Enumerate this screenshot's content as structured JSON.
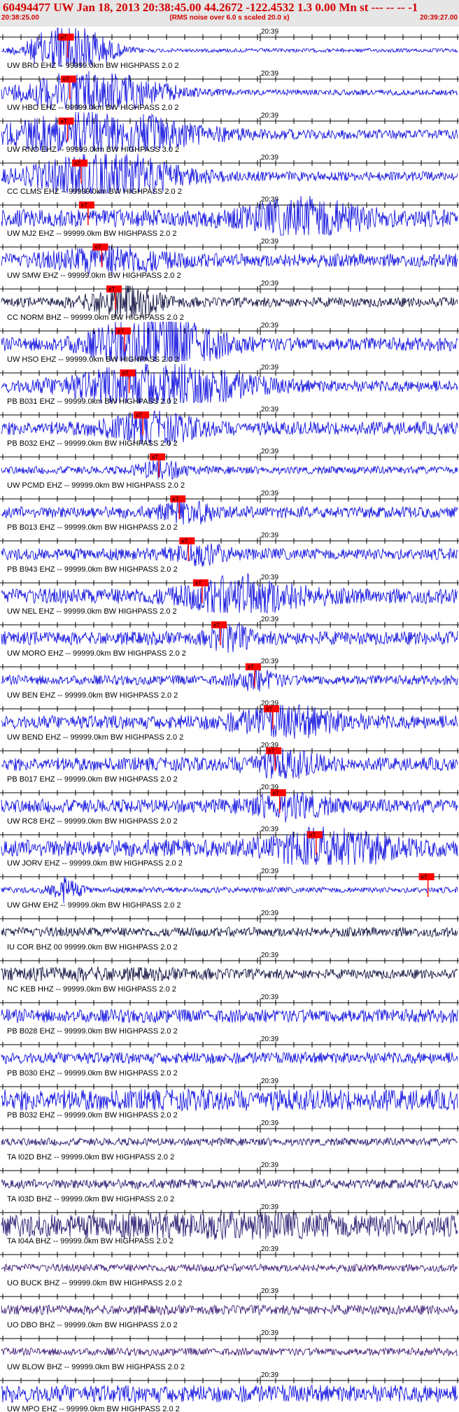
{
  "header": {
    "title": "60494477 UW Jan 18, 2013 20:38:45.00   44.2672 -122.4532  1.3 0.00 Mn st --- -- --  -1",
    "start_time": "20:38:25.00",
    "center_text": "(RMS noise over 6.0 s scaled 20.0 x)",
    "end_time": "20:39:27.00"
  },
  "time_mark_label": "20:39",
  "pick_label": "eT",
  "colors": {
    "header_text": "#d40000",
    "header_bg": "#e6e6e6",
    "trace_blue": "#0000dd",
    "trace_dark": "#000033",
    "trace_navy": "#1a0a66",
    "trace_purple": "#33106e",
    "pick": "#ff0000",
    "axis": "#000000"
  },
  "traces": [
    {
      "label": "UW BRO EHZ -- 99999.0km BW  HIGHPASS  2.0  2",
      "color": "blue",
      "pick": 0.145,
      "ev": 0.15,
      "amp": 0.1,
      "ea": 1.6,
      "ew": 0.08
    },
    {
      "label": "UW HBO EHZ -- 99999.0km BW  HIGHPASS  2.0  2",
      "color": "blue",
      "pick": 0.15,
      "ev": 0.2,
      "amp": 0.15,
      "ea": 1.1,
      "ew": 0.15
    },
    {
      "label": "UW RNO EHZ -- 99999.0km BW  HIGHPASS  3.0  2",
      "color": "blue",
      "pick": 0.145,
      "ev": 0.22,
      "amp": 0.25,
      "ea": 1.1,
      "ew": 0.2
    },
    {
      "label": "CC CLMS EHZ -- 99999.0km BW  HIGHPASS  2.0  2",
      "color": "blue",
      "pick": 0.175,
      "ev": 0.23,
      "amp": 0.25,
      "ea": 1.2,
      "ew": 0.15
    },
    {
      "label": "UW MJ2 EHZ -- 99999.0km BW  HIGHPASS  2.0  2",
      "color": "blue",
      "pick": 0.19,
      "ev": 0.67,
      "amp": 0.45,
      "ea": 0.8,
      "ew": 0.12
    },
    {
      "label": "UW SMW EHZ -- 99999.0km BW  HIGHPASS  2.0  2",
      "color": "blue",
      "pick": 0.22,
      "ev": 0.24,
      "amp": 0.35,
      "ea": 0.5,
      "ew": 0.12
    },
    {
      "label": "CC NORM BHZ -- 99999.0km BW  HIGHPASS  2.0  2",
      "color": "dark",
      "pick": 0.25,
      "ev": 0.27,
      "amp": 0.25,
      "ea": 0.7,
      "ew": 0.08
    },
    {
      "label": "UW HSO EHZ -- 99999.0km BW  HIGHPASS  2.0  2",
      "color": "blue",
      "pick": 0.27,
      "ev": 0.34,
      "amp": 0.35,
      "ea": 1.6,
      "ew": 0.12
    },
    {
      "label": "PB B031 EHZ -- 99999.0km BW  HIGHPASS  2.0  2",
      "color": "blue",
      "pick": 0.28,
      "ev": 0.35,
      "amp": 0.3,
      "ea": 1.1,
      "ew": 0.18
    },
    {
      "label": "PB B032 EHZ -- 99999.0km BW  HIGHPASS  2.0  2",
      "color": "blue",
      "pick": 0.31,
      "ev": 0.33,
      "amp": 0.35,
      "ea": 0.6,
      "ew": 0.1
    },
    {
      "label": "UW PCMD EHZ -- 99999.0km BW  HIGHPASS  2.0  2",
      "color": "blue",
      "pick": 0.345,
      "ev": 0.35,
      "amp": 0.2,
      "ea": 0.4,
      "ew": 0.05
    },
    {
      "label": "PB B013 EHZ -- 99999.0km BW  HIGHPASS  2.0  2",
      "color": "blue",
      "pick": 0.39,
      "ev": 0.41,
      "amp": 0.3,
      "ea": 0.4,
      "ew": 0.06
    },
    {
      "label": "PB B943 EHZ -- 99999.0km BW  HIGHPASS  2.0  2",
      "color": "blue",
      "pick": 0.41,
      "ev": 0.43,
      "amp": 0.3,
      "ea": 0.4,
      "ew": 0.06
    },
    {
      "label": "UW NEL EHZ -- 99999.0km BW  HIGHPASS  2.0  2",
      "color": "blue",
      "pick": 0.44,
      "ev": 0.53,
      "amp": 0.4,
      "ea": 0.8,
      "ew": 0.12
    },
    {
      "label": "UW MORO EHZ -- 99999.0km BW  HIGHPASS  2.0  2",
      "color": "blue",
      "pick": 0.48,
      "ev": 0.5,
      "amp": 0.35,
      "ea": 0.6,
      "ew": 0.04
    },
    {
      "label": "UW BEN EHZ -- 99999.0km BW  HIGHPASS  2.0  2",
      "color": "blue",
      "pick": 0.555,
      "ev": 0.56,
      "amp": 0.25,
      "ea": 0.4,
      "ew": 0.05
    },
    {
      "label": "UW BEND EHZ -- 99999.0km BW  HIGHPASS  2.0  2",
      "color": "blue",
      "pick": 0.595,
      "ev": 0.63,
      "amp": 0.35,
      "ea": 0.6,
      "ew": 0.12
    },
    {
      "label": "PB B017 EHZ -- 99999.0km BW  HIGHPASS  2.0  2",
      "color": "blue",
      "pick": 0.6,
      "ev": 0.62,
      "amp": 0.35,
      "ea": 0.5,
      "ew": 0.08
    },
    {
      "label": "UW RC8 EHZ -- 99999.0km BW  HIGHPASS  2.0  2",
      "color": "blue",
      "pick": 0.61,
      "ev": 0.63,
      "amp": 0.35,
      "ea": 0.5,
      "ew": 0.08
    },
    {
      "label": "UW JORV EHZ -- 99999.0km BW  HIGHPASS  2.0  2",
      "color": "blue",
      "pick": 0.69,
      "ev": 0.72,
      "amp": 0.45,
      "ea": 0.8,
      "ew": 0.12
    },
    {
      "label": "UW GHW EHZ -- 99999.0km BW  HIGHPASS  2.0  2",
      "color": "blue",
      "pick": 0.935,
      "ev": 0.14,
      "amp": 0.15,
      "ea": 0.6,
      "ew": 0.03
    },
    {
      "label": "IU COR BHZ 00 99999.0km BW  HIGHPASS  2.0  2",
      "color": "dark",
      "pick": null,
      "ev": 0.5,
      "amp": 0.25,
      "ea": 0,
      "ew": 0.1
    },
    {
      "label": "NC KEB HHZ -- 99999.0km BW  HIGHPASS  2.0  2",
      "color": "dark",
      "pick": null,
      "ev": 0.2,
      "amp": 0.25,
      "ea": 0.15,
      "ew": 0.25
    },
    {
      "label": "PB B028 EHZ -- 99999.0km BW  HIGHPASS  2.0  2",
      "color": "blue",
      "pick": null,
      "ev": 0.5,
      "amp": 0.35,
      "ea": 0,
      "ew": 0.1
    },
    {
      "label": "PB B030 EHZ -- 99999.0km BW  HIGHPASS  2.0  2",
      "color": "blue",
      "pick": null,
      "ev": 0.5,
      "amp": 0.3,
      "ea": 0,
      "ew": 0.1
    },
    {
      "label": "PB B032 EHZ -- 99999.0km BW  HIGHPASS  2.0  2",
      "color": "blue",
      "pick": null,
      "ev": 0.5,
      "amp": 0.55,
      "ea": 0,
      "ew": 0.1
    },
    {
      "label": "TA I02D BHZ -- 99999.0km BW  HIGHPASS  2.0  2",
      "color": "navy",
      "pick": null,
      "ev": 0.5,
      "amp": 0.2,
      "ea": 0,
      "ew": 0.1
    },
    {
      "label": "TA I03D BHZ -- 99999.0km BW  HIGHPASS  2.0  2",
      "color": "navy",
      "pick": null,
      "ev": 0.5,
      "amp": 0.25,
      "ea": 0,
      "ew": 0.1
    },
    {
      "label": "TA I04A BHZ -- 99999.0km BW  HIGHPASS  2.0  2",
      "color": "navy",
      "pick": null,
      "ev": 0.5,
      "amp": 0.55,
      "ea": 0.2,
      "ew": 0.3
    },
    {
      "label": "UO BUCK BHZ -- 99999.0km BW  HIGHPASS  2.0  2",
      "color": "purple",
      "pick": null,
      "ev": 0.5,
      "amp": 0.2,
      "ea": 0,
      "ew": 0.1
    },
    {
      "label": "UO DBO BHZ -- 99999.0km BW  HIGHPASS  2.0  2",
      "color": "purple",
      "pick": null,
      "ev": 0.5,
      "amp": 0.25,
      "ea": 0,
      "ew": 0.1
    },
    {
      "label": "UW BLOW BHZ -- 99999.0km BW  HIGHPASS  2.0  2",
      "color": "purple",
      "pick": null,
      "ev": 0.5,
      "amp": 0.2,
      "ea": 0,
      "ew": 0.1
    },
    {
      "label": "UW MPO EHZ -- 99999.0km BW  HIGHPASS  2.0  2",
      "color": "blue",
      "pick": null,
      "ev": 0.5,
      "amp": 0.45,
      "ea": 0,
      "ew": 0.1
    }
  ]
}
